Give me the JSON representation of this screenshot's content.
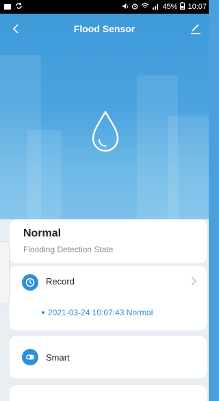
{
  "status_bar": {
    "battery_percent": "45%",
    "time": "10:07"
  },
  "header": {
    "title": "Flood Sensor"
  },
  "state": {
    "value": "Normal",
    "label": "Flooding Detection State"
  },
  "record": {
    "label": "Record",
    "latest_entry": "2021-03-24 10:07:43 Normal"
  },
  "smart": {
    "label": "Smart"
  },
  "colors": {
    "accent": "#2f8fd8",
    "hero_blue": "#4aa3df"
  },
  "icons": {
    "back": "chevron-left-icon",
    "edit": "pencil-icon",
    "drop": "water-drop-icon",
    "record": "clock-icon",
    "smart": "toggle-icon"
  }
}
